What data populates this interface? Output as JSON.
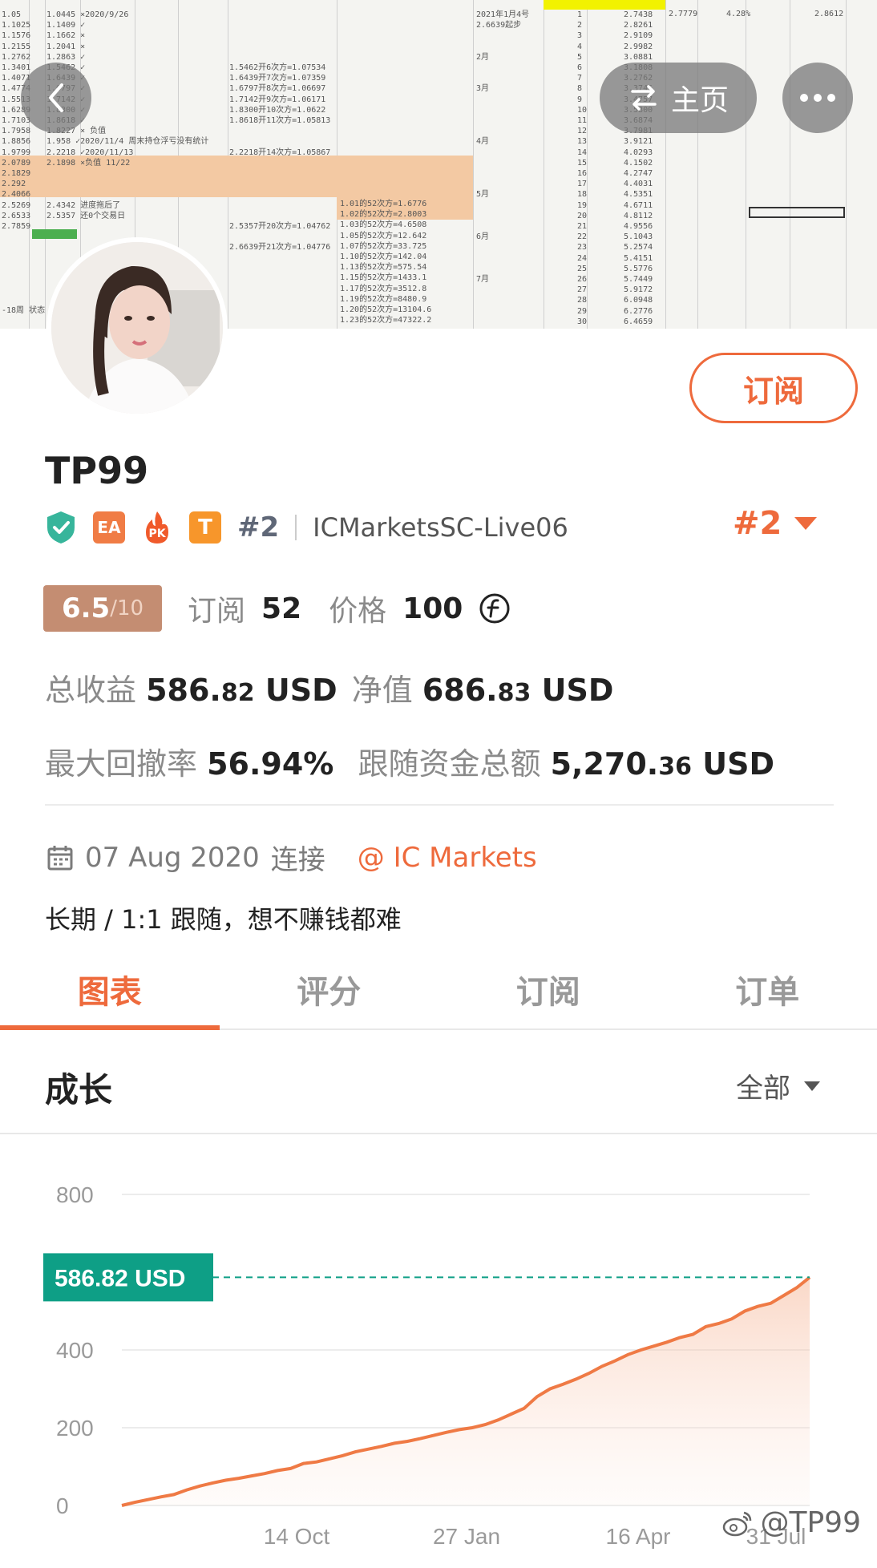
{
  "nav": {
    "home_label": "主页"
  },
  "header": {
    "subscribe_label": "订阅"
  },
  "profile": {
    "name": "TP99",
    "badges": [
      "EA",
      "PK",
      "T"
    ],
    "rank": "#2",
    "server": "ICMarketsSC-Live06",
    "rank_right": "#2"
  },
  "stats": {
    "score": "6.5",
    "score_max": "/10",
    "subscribe_label": "订阅",
    "subscribe_count": "52",
    "price_label": "价格",
    "price_value": "100",
    "total_profit_label": "总收益",
    "total_profit_int": "586.",
    "total_profit_dec": "82",
    "total_profit_unit": "USD",
    "equity_label": "净值",
    "equity_int": "686.",
    "equity_dec": "83",
    "equity_unit": "USD",
    "drawdown_label": "最大回撤率",
    "drawdown_value": "56.94%",
    "follow_label": "跟随资金总额",
    "follow_int": "5,270.",
    "follow_dec": "36",
    "follow_unit": "USD"
  },
  "connect": {
    "date": "07 Aug 2020",
    "connect_label": "连接",
    "broker": "@ IC Markets"
  },
  "description": "长期 / 1:1 跟随，想不赚钱都难",
  "tabs": [
    {
      "label": "图表"
    },
    {
      "label": "评分"
    },
    {
      "label": "订阅"
    },
    {
      "label": "订单"
    }
  ],
  "section": {
    "title": "成长",
    "filter": "全部"
  },
  "watermark": "@TP99",
  "colors": {
    "accent": "#ee6a3c",
    "score_bg": "#c48d72",
    "chart_line": "#ef7a45",
    "tag_bg": "#0e9f86"
  },
  "chart_data": {
    "type": "area",
    "ylim": [
      0,
      800
    ],
    "yticks": [
      0,
      200,
      400,
      800
    ],
    "xticks": [
      "14 Oct",
      "27 Jan",
      "16 Apr",
      "31 Jul"
    ],
    "current_label": "586.82 USD",
    "current_value": 586.82,
    "series": [
      {
        "values": [
          0,
          8,
          15,
          22,
          28,
          40,
          50,
          58,
          65,
          70,
          76,
          82,
          90,
          95,
          108,
          112,
          120,
          128,
          138,
          145,
          152,
          160,
          165,
          172,
          180,
          188,
          195,
          200,
          208,
          220,
          235,
          250,
          280,
          300,
          312,
          325,
          340,
          358,
          372,
          388,
          400,
          410,
          420,
          432,
          440,
          460,
          468,
          480,
          500,
          512,
          520,
          540,
          560,
          586.82
        ]
      }
    ]
  }
}
